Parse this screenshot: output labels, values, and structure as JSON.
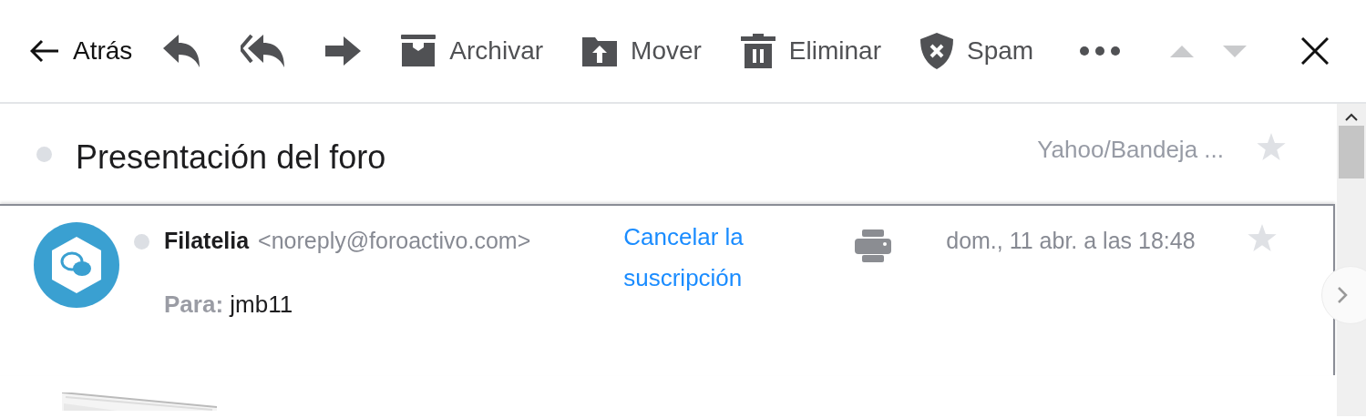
{
  "toolbar": {
    "back_label": "Atrás",
    "actions": [
      {
        "kind": "reply"
      },
      {
        "kind": "reply_all"
      },
      {
        "kind": "forward"
      },
      {
        "kind": "archive",
        "label": "Archivar"
      },
      {
        "kind": "move",
        "label": "Mover"
      },
      {
        "kind": "delete",
        "label": "Eliminar"
      },
      {
        "kind": "spam",
        "label": "Spam"
      },
      {
        "kind": "more"
      }
    ],
    "nav": [
      {
        "kind": "up",
        "disabled": true
      },
      {
        "kind": "down",
        "disabled": true
      }
    ]
  },
  "subject": {
    "text": "Presentación del foro",
    "unread": false,
    "folder": "Yahoo/Bandeja ...",
    "starred": false
  },
  "message": {
    "sender_name": "Filatelia",
    "sender_email": "<noreply@foroactivo.com>",
    "unsubscribe": "Cancelar la suscripción",
    "date": "dom., 11 abr. a las 18:48",
    "unread": false,
    "starred": false,
    "to_label": "Para:",
    "to": "jmb11"
  }
}
